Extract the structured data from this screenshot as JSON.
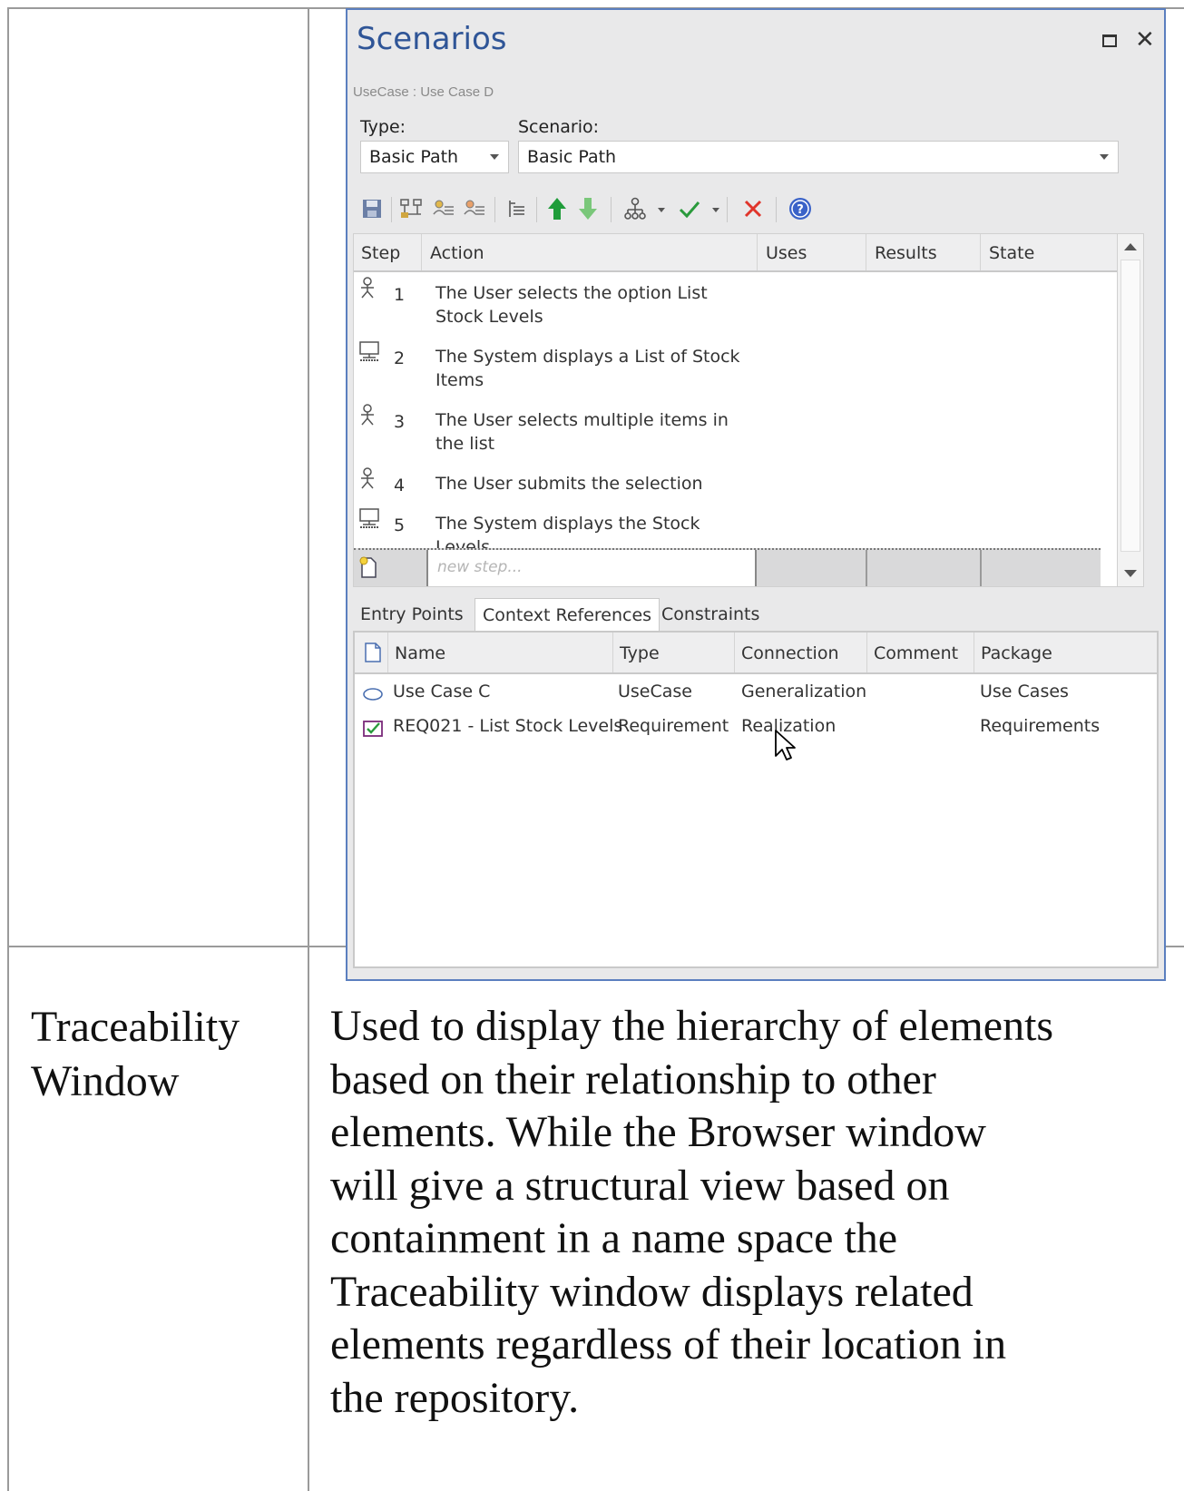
{
  "window": {
    "title": "Scenarios",
    "subtitle": "UseCase : Use Case D",
    "type_label": "Type:",
    "type_value": "Basic Path",
    "scenario_label": "Scenario:",
    "scenario_value": "Basic Path"
  },
  "toolbar_icons": [
    "save-icon",
    "generate-structure-icon",
    "add-actor-step-icon",
    "add-system-step-icon",
    "indent-icon",
    "move-up-icon",
    "move-down-icon",
    "generate-diagram-icon",
    "validate-icon",
    "delete-icon",
    "help-icon"
  ],
  "steps_grid": {
    "headers": [
      "Step",
      "Action",
      "Uses",
      "Results",
      "State"
    ],
    "rows": [
      {
        "icon": "actor-icon",
        "num": "1",
        "action_line1": "The User selects the option List",
        "action_line2": "Stock Levels"
      },
      {
        "icon": "system-icon",
        "num": "2",
        "action_line1": "The System displays a List of Stock",
        "action_line2": "Items"
      },
      {
        "icon": "actor-icon",
        "num": "3",
        "action_line1": "The User selects multiple items in",
        "action_line2": "the list"
      },
      {
        "icon": "actor-icon",
        "num": "4",
        "action_line1": "The User submits the selection",
        "action_line2": ""
      },
      {
        "icon": "system-icon",
        "num": "5",
        "action_line1": "The System displays the Stock Levels",
        "action_line2": ""
      }
    ],
    "new_step_placeholder": "new step..."
  },
  "tabs": [
    "Entry Points",
    "Context References",
    "Constraints"
  ],
  "active_tab": "Context References",
  "references": {
    "headers": [
      "Name",
      "Type",
      "Connection",
      "Comment",
      "Package"
    ],
    "rows": [
      {
        "icon": "usecase-icon",
        "name": "Use Case C",
        "type": "UseCase",
        "connection": "Generalization",
        "comment": "",
        "package": "Use Cases"
      },
      {
        "icon": "requirement-icon",
        "name": "REQ021 - List Stock Levels",
        "type": "Requirement",
        "connection": "Realization",
        "comment": "",
        "package": "Requirements"
      }
    ]
  },
  "doc": {
    "term_line1": "Traceability",
    "term_line2": "Window",
    "desc_lines": [
      "Used to display the hierarchy of elements",
      "based on their relationship to other",
      "elements. While the Browser window",
      "will give a structural view based on",
      "containment in a name space the",
      "Traceability window displays related",
      "elements regardless of their location in",
      "the repository."
    ]
  },
  "colors": {
    "title": "#2f5597",
    "window_border": "#5b7fbf",
    "arrow_green": "#1f9c3a",
    "delete_red": "#e0352b",
    "help_blue": "#3a62c8"
  }
}
